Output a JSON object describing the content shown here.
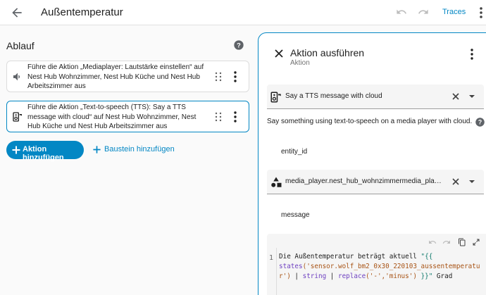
{
  "header": {
    "title": "Außentemperatur",
    "traces_label": "Traces"
  },
  "flow": {
    "heading": "Ablauf",
    "actions": [
      {
        "icon": "speaker-volume-icon",
        "text": "Führe die Aktion „Mediaplayer: Lautstärke einstellen“ auf Nest Hub Wohnzimmer, Nest Hub Küche und Nest Hub Arbeitszimmer aus"
      },
      {
        "icon": "tts-speaker-icon",
        "text": "Führe die Aktion „Text-to-speech (TTS): Say a TTS message with cloud“ auf Nest Hub Wohnzimmer, Nest Hub Küche und Nest Hub Arbeitszimmer aus"
      }
    ],
    "add_action_label": "Aktion hinzufügen",
    "add_block_label": "Baustein hinzufügen"
  },
  "panel": {
    "title": "Aktion ausführen",
    "subtitle": "Aktion",
    "action_select_value": "Say a TTS message with cloud",
    "description": "Say something using text-to-speech on a media player with cloud.",
    "entity_label": "entity_id",
    "entity_value": "media_player.nest_hub_wohnzimmermedia_player.ne...",
    "message_label": "message",
    "code_line_number": "1",
    "code": {
      "line1_plain": "Die Außentemperatur beträgt aktuell ",
      "line1_tmpl": "\"{{",
      "line2_fn": "states",
      "line2_str": "('sensor.wolf_bm2_0x30_220103_aussentemperatu",
      "line3_str": "r')",
      "line3_a": " | ",
      "line3_kw1": "string",
      "line3_b": " | ",
      "line3_kw2": "replace",
      "line3_args": "('-','minus')",
      "line3_tmpl": " }}\"",
      "line3_end": " Grad"
    }
  },
  "colors": {
    "accent": "#0387c4"
  }
}
